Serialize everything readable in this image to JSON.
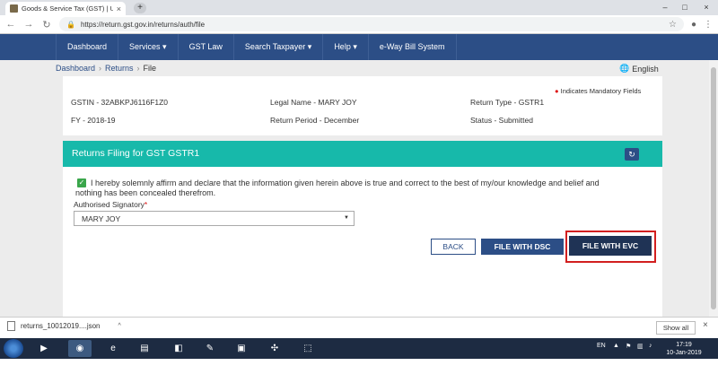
{
  "browser": {
    "tab_title": "Goods & Service Tax (GST) | User",
    "tab_close": "×",
    "new_tab": "+",
    "url": "https://return.gst.gov.in/returns/auth/file",
    "win_min": "–",
    "win_max": "□",
    "win_close": "×"
  },
  "site_nav": {
    "items": [
      "Dashboard",
      "Services ▾",
      "GST Law",
      "Search Taxpayer ▾",
      "Help ▾",
      "e-Way Bill System"
    ]
  },
  "breadcrumb": {
    "items": [
      "Dashboard",
      "Returns",
      "File"
    ],
    "separator": "›"
  },
  "language": "English",
  "info": {
    "mandatory_note": "Indicates Mandatory Fields",
    "gstin": "GSTIN - 32ABKPJ6116F1Z0",
    "legal_name": "Legal Name - MARY JOY",
    "return_type": "Return Type - GSTR1",
    "fy": "FY - 2018-19",
    "return_period": "Return Period - December",
    "status": "Status - Submitted"
  },
  "panel": {
    "title": "Returns Filing for GST GSTR1",
    "declaration_line1": "I hereby solemnly affirm and declare that the information given herein above is true and correct to the best of my/our knowledge and belief and",
    "declaration_line2": "nothing has been concealed therefrom.",
    "signatory_label": "Authorised Signatory",
    "signatory_value": "MARY JOY",
    "btn_back": "BACK",
    "btn_dsc": "FILE WITH DSC",
    "btn_evc": "FILE WITH EVC"
  },
  "downloads": {
    "file_name": "returns_10012019....json",
    "menu": "^",
    "show_all": "Show all",
    "close": "×"
  },
  "taskbar": {
    "lang": "EN",
    "time": "17:19",
    "date": "10-Jan-2019"
  },
  "colors": {
    "nav_blue": "#2c4e86",
    "panel_teal": "#17b9aa",
    "highlight_red": "#d21f1f"
  }
}
